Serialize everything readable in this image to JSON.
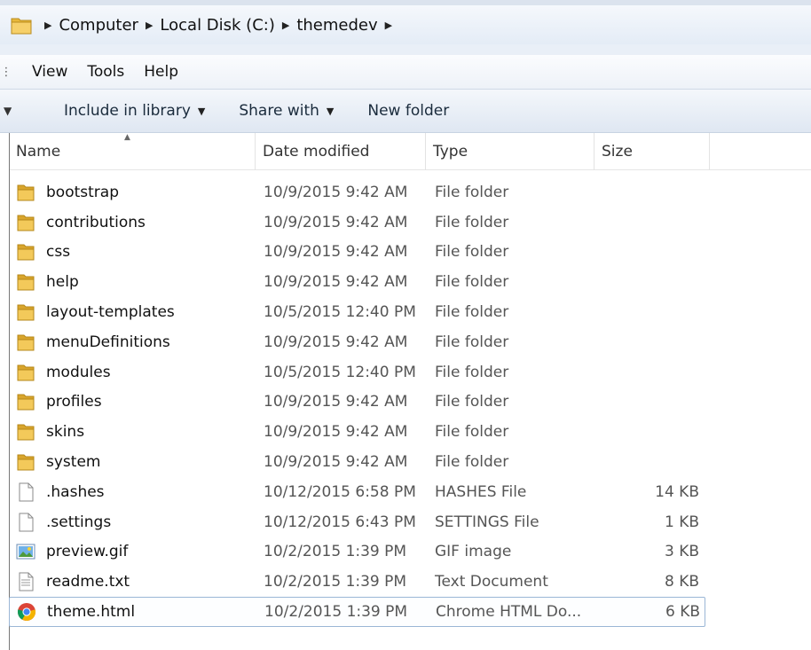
{
  "address": {
    "crumbs": [
      "Computer",
      "Local Disk (C:)",
      "themedev"
    ]
  },
  "menu": {
    "items": [
      "View",
      "Tools",
      "Help"
    ]
  },
  "toolbar": {
    "include_label": "Include in library",
    "share_label": "Share with",
    "new_folder_label": "New folder"
  },
  "columns": {
    "name": "Name",
    "date": "Date modified",
    "type": "Type",
    "size": "Size"
  },
  "files": [
    {
      "name": "bootstrap",
      "date": "10/9/2015 9:42 AM",
      "type": "File folder",
      "size": "",
      "icon": "folder-icon"
    },
    {
      "name": "contributions",
      "date": "10/9/2015 9:42 AM",
      "type": "File folder",
      "size": "",
      "icon": "folder-icon"
    },
    {
      "name": "css",
      "date": "10/9/2015 9:42 AM",
      "type": "File folder",
      "size": "",
      "icon": "folder-icon"
    },
    {
      "name": "help",
      "date": "10/9/2015 9:42 AM",
      "type": "File folder",
      "size": "",
      "icon": "folder-icon"
    },
    {
      "name": "layout-templates",
      "date": "10/5/2015 12:40 PM",
      "type": "File folder",
      "size": "",
      "icon": "folder-icon"
    },
    {
      "name": "menuDefinitions",
      "date": "10/9/2015 9:42 AM",
      "type": "File folder",
      "size": "",
      "icon": "folder-icon"
    },
    {
      "name": "modules",
      "date": "10/5/2015 12:40 PM",
      "type": "File folder",
      "size": "",
      "icon": "folder-icon"
    },
    {
      "name": "profiles",
      "date": "10/9/2015 9:42 AM",
      "type": "File folder",
      "size": "",
      "icon": "folder-icon"
    },
    {
      "name": "skins",
      "date": "10/9/2015 9:42 AM",
      "type": "File folder",
      "size": "",
      "icon": "folder-icon"
    },
    {
      "name": "system",
      "date": "10/9/2015 9:42 AM",
      "type": "File folder",
      "size": "",
      "icon": "folder-icon"
    },
    {
      "name": ".hashes",
      "date": "10/12/2015 6:58 PM",
      "type": "HASHES File",
      "size": "14 KB",
      "icon": "file-icon"
    },
    {
      "name": ".settings",
      "date": "10/12/2015 6:43 PM",
      "type": "SETTINGS File",
      "size": "1 KB",
      "icon": "file-icon"
    },
    {
      "name": "preview.gif",
      "date": "10/2/2015 1:39 PM",
      "type": "GIF image",
      "size": "3 KB",
      "icon": "image-icon"
    },
    {
      "name": "readme.txt",
      "date": "10/2/2015 1:39 PM",
      "type": "Text Document",
      "size": "8 KB",
      "icon": "text-file-icon"
    },
    {
      "name": "theme.html",
      "date": "10/2/2015 1:39 PM",
      "type": "Chrome HTML Do...",
      "size": "6 KB",
      "icon": "chrome-icon",
      "selected": true
    }
  ],
  "colors": {
    "folder": "#e8b73a",
    "selection_border": "#9ab6d6",
    "toolbar_text": "#1a2b3c"
  }
}
